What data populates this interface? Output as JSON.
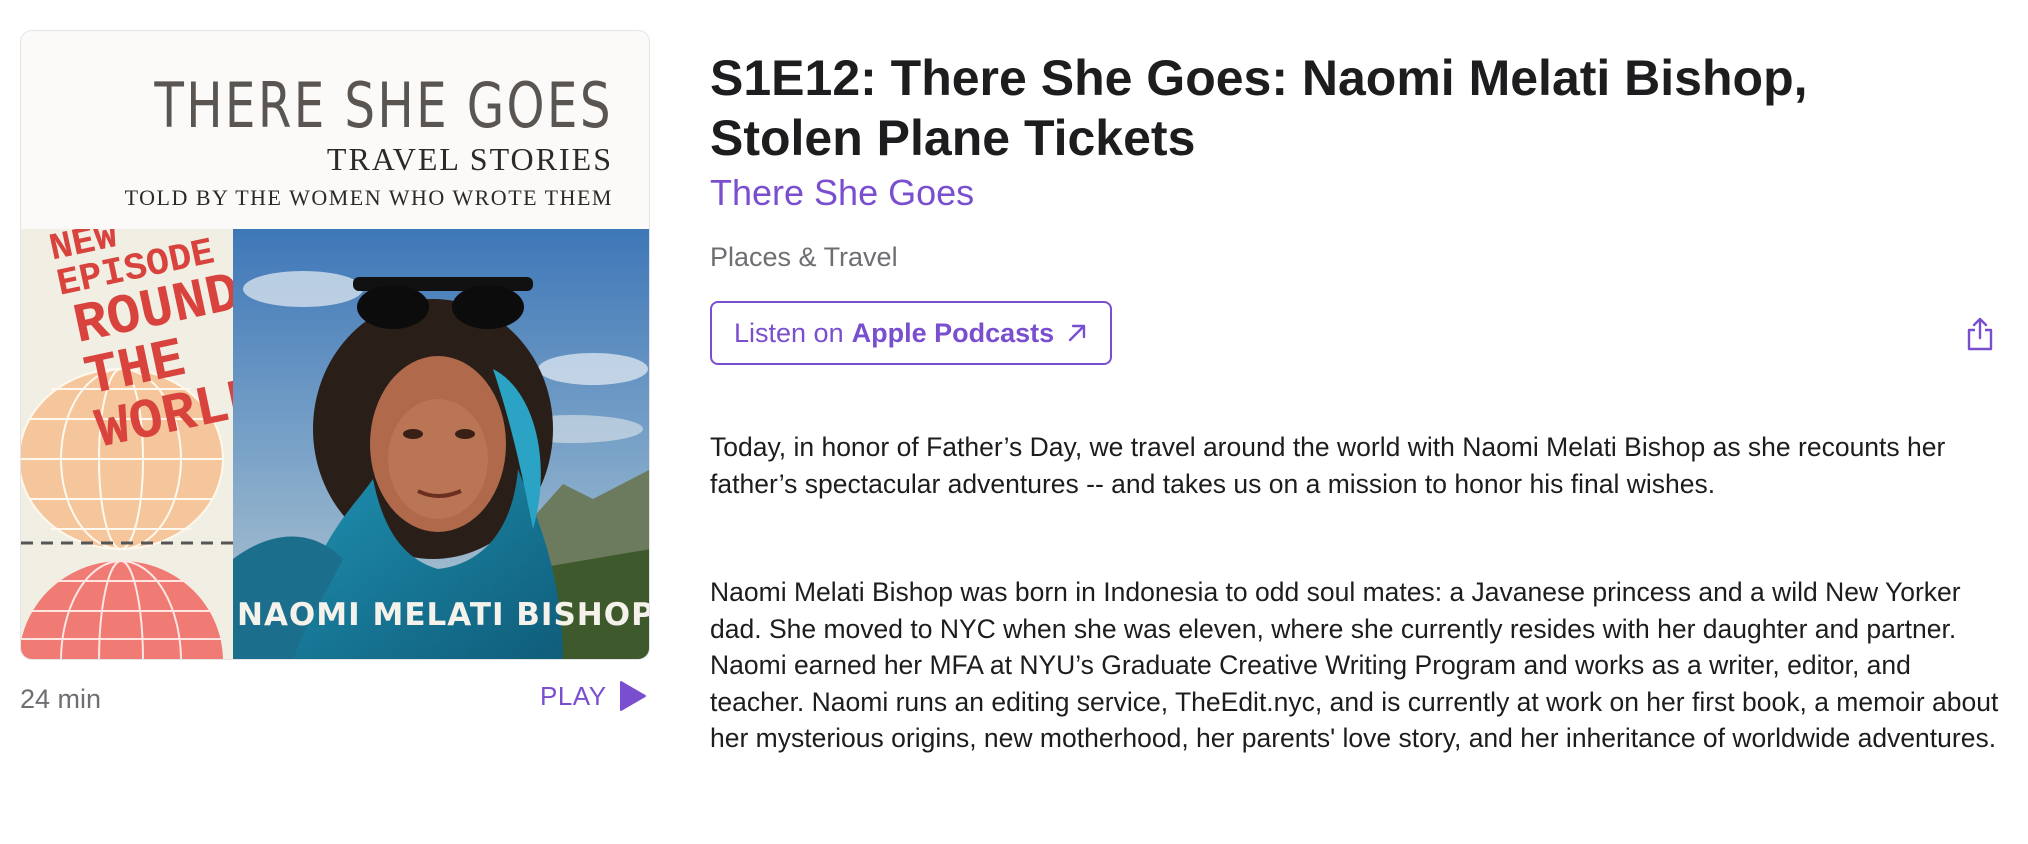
{
  "artwork": {
    "title": "THERE SHE GOES",
    "subtitle": "TRAVEL STORIES",
    "tagline": "TOLD BY THE WOMEN WHO WROTE THEM",
    "stamp": [
      "NEW",
      "EPISODE",
      "ROUND",
      "THE",
      "WORLD"
    ],
    "guest_name": "NAOMI MELATI BISHOP"
  },
  "episode": {
    "duration": "24 min",
    "play_label": "PLAY",
    "title": "S1E12: There She Goes: Naomi Melati Bishop, Stolen Plane Tickets",
    "show_name": "There She Goes",
    "category": "Places & Travel",
    "listen_prefix": "Listen on",
    "listen_brand": "Apple Podcasts",
    "description": [
      "Today, in honor of Father’s Day, we travel around the world with Naomi Melati Bishop as she recounts her father’s spectacular adventures -- and takes us on a mission to honor his final wishes.",
      "Naomi Melati Bishop was born in Indonesia to odd soul mates: a Javanese princess and a wild New Yorker dad. She moved to NYC when she was eleven, where she currently resides with her daughter and partner. Naomi earned her MFA at NYU’s Graduate Creative Writing Program and works as a writer, editor, and teacher. Naomi runs an editing service, TheEdit.nyc, and is currently at work on her first book, a memoir about her mysterious origins, new motherhood, her parents' love story, and her inheritance of worldwide adventures."
    ]
  },
  "colors": {
    "accent": "#7a4fcf",
    "text_primary": "#1d1d1f",
    "text_secondary": "#6e6e73",
    "stamp_red": "#d8443d"
  },
  "icons": {
    "play": "play-triangle-icon",
    "external": "arrow-up-right-icon",
    "share": "share-icon"
  }
}
